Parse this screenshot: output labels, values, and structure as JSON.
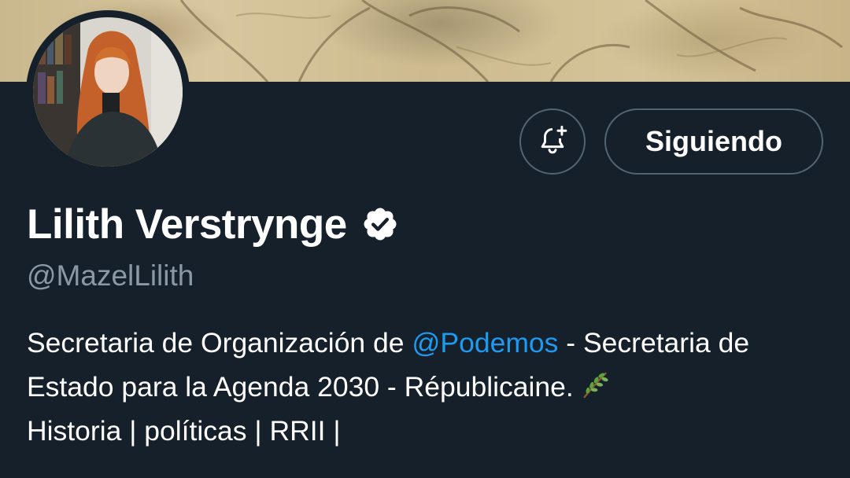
{
  "profile": {
    "display_name": "Lilith Verstrynge",
    "handle": "@MazelLilith",
    "verified": true
  },
  "actions": {
    "follow_label": "Siguiendo",
    "notify_icon": "bell-plus-icon"
  },
  "bio": {
    "part1": "Secretaria de Organización de ",
    "mention": "@Podemos",
    "part2": " - Secretaria de Estado para la Agenda 2030 - Républicaine.",
    "emoji": "herb-icon",
    "part3": "Historia | políticas | RRII |"
  },
  "colors": {
    "background": "#15202b",
    "link": "#1d9bf0",
    "muted": "#8b98a5",
    "border": "#536471"
  }
}
